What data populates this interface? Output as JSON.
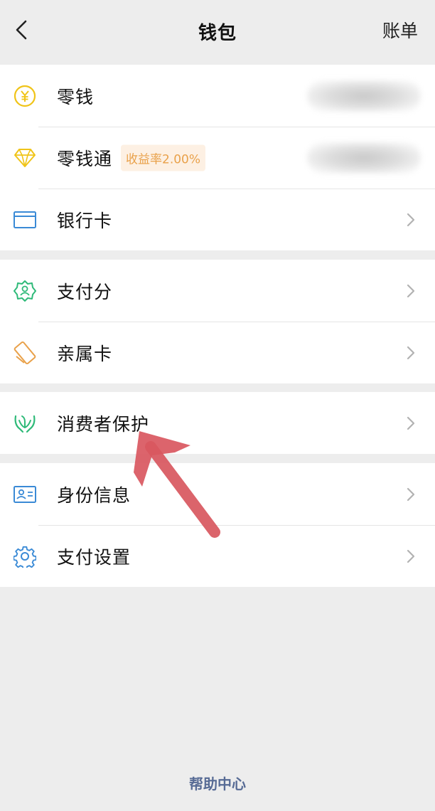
{
  "header": {
    "title": "钱包",
    "bill_label": "账单"
  },
  "groups": [
    {
      "items": [
        {
          "label": "零钱",
          "icon": "yuan-coin-icon"
        },
        {
          "label": "零钱通",
          "icon": "diamond-icon",
          "badge": "收益率2.00%"
        },
        {
          "label": "银行卡",
          "icon": "bank-card-icon"
        }
      ]
    },
    {
      "items": [
        {
          "label": "支付分",
          "icon": "credit-score-icon"
        },
        {
          "label": "亲属卡",
          "icon": "family-card-icon"
        }
      ]
    },
    {
      "items": [
        {
          "label": "消费者保护",
          "icon": "protection-hands-icon"
        }
      ]
    },
    {
      "items": [
        {
          "label": "身份信息",
          "icon": "id-card-icon"
        },
        {
          "label": "支付设置",
          "icon": "gear-icon"
        }
      ]
    }
  ],
  "footer": {
    "help_label": "帮助中心"
  },
  "colors": {
    "background": "#ededed",
    "yellow": "#f0c419",
    "blue": "#3a8ad6",
    "green": "#2fba79",
    "orange": "#e9a14a",
    "link": "#576b95",
    "annotation_arrow": "#d9575f"
  }
}
